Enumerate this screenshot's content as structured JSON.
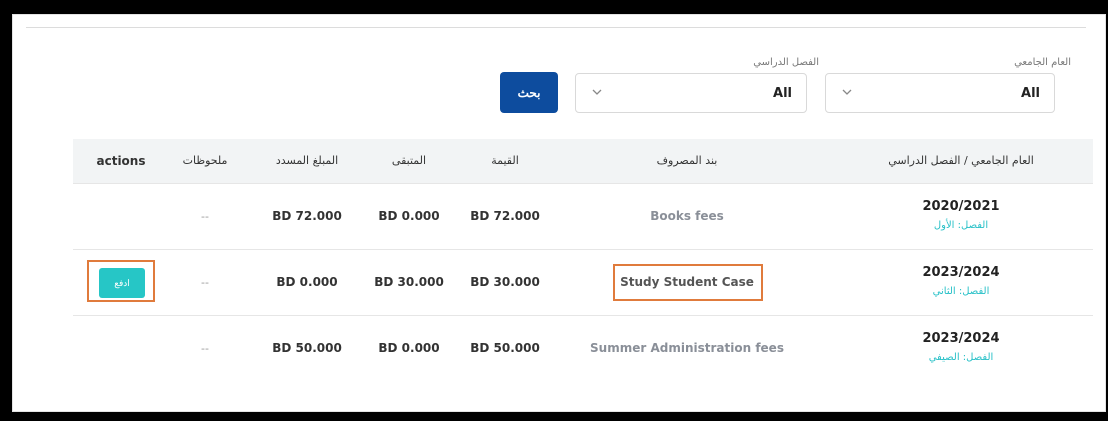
{
  "filters": {
    "year_label": "العام الجامعي",
    "year_value": "All",
    "semester_label": "الفصل الدراسي",
    "semester_value": "All",
    "search_label": "بحث"
  },
  "table": {
    "headers": {
      "year_semester": "العام الجامعي / الفصل الدراسي",
      "expense_item": "بند المصروف",
      "value": "القيمة",
      "remaining": "المتبقى",
      "paid": "المبلغ المسدد",
      "notes": "ملحوظات",
      "actions": "actions"
    },
    "rows": [
      {
        "year": "2020/2021",
        "semester": "الفصل: الأول",
        "item": "Books fees",
        "value": "BD 72.000",
        "remaining": "BD 0.000",
        "paid": "BD 72.000",
        "notes": "--"
      },
      {
        "year": "2023/2024",
        "semester": "الفصل: الثاني",
        "item": "Study Student Case",
        "value": "BD 30.000",
        "remaining": "BD 30.000",
        "paid": "BD 0.000",
        "notes": "--",
        "action_label": "ادفع"
      },
      {
        "year": "2023/2024",
        "semester": "الفصل: الصيفي",
        "item": "Summer Administration fees",
        "value": "BD 50.000",
        "remaining": "BD 0.000",
        "paid": "BD 50.000",
        "notes": "--"
      }
    ]
  },
  "colors": {
    "accent": "#0d4c9e",
    "teal": "#26c6c6",
    "highlight": "#e07b3c"
  },
  "icons": [
    "chevron-down-icon"
  ]
}
